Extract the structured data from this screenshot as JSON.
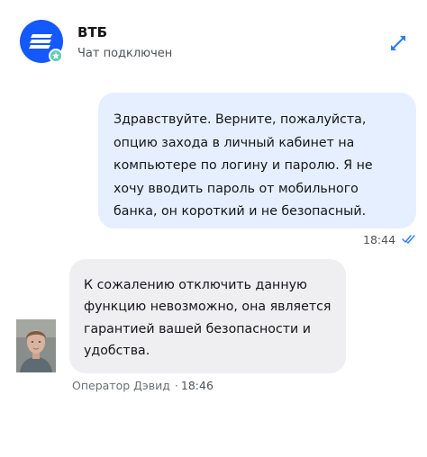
{
  "header": {
    "title": "ВТБ",
    "subtitle": "Чат подключен",
    "logo_icon": "vtb-logo-icon",
    "status_icon": "online-badge-icon",
    "expand_icon": "expand-icon"
  },
  "messages": [
    {
      "direction": "outgoing",
      "text": "Здравствуйте. Верните, пожалуйста, опцию захода в личный кабинет на компьютере по логину и паролю. Я не хочу вводить пароль от мобильного банка, он короткий и не безопасный.",
      "time": "18:44",
      "status_icon": "double-check-icon"
    },
    {
      "direction": "incoming",
      "text": "К сожалению отключить данную функцию невозможно, она является гарантией вашей безопасности и удобства.",
      "sender": "Оператор Дэвид",
      "separator": "·",
      "time": "18:46",
      "avatar_icon": "operator-avatar"
    }
  ],
  "colors": {
    "brand": "#1459ff",
    "outgoing_bubble": "#e5efff",
    "incoming_bubble": "#efeff1",
    "online": "#63c9b4",
    "accent_icon": "#2b7bf0"
  }
}
